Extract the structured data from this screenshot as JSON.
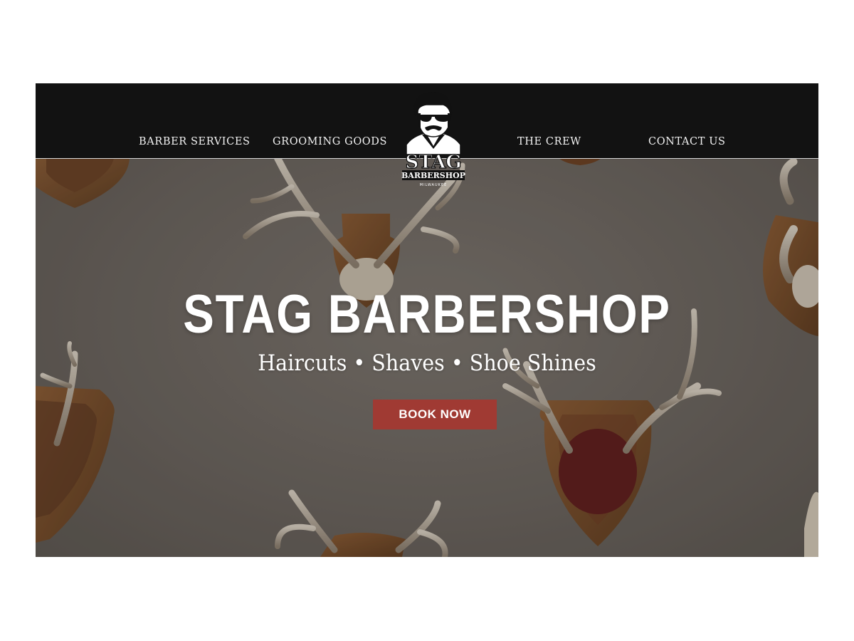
{
  "brand": {
    "logo_name": "STAG",
    "logo_sub": "BARBERSHOP",
    "logo_city": "MILWAUKEE",
    "logo_icon": "mustached-man-sunglasses-icon"
  },
  "nav": {
    "items": [
      {
        "label": "BARBER SERVICES"
      },
      {
        "label": "GROOMING GOODS"
      },
      {
        "label": "THE CREW"
      },
      {
        "label": "CONTACT US"
      }
    ]
  },
  "hero": {
    "title": "STAG BARBERSHOP",
    "subtitle": "Haircuts • Shaves • Shoe Shines",
    "cta_label": "BOOK NOW",
    "background": "mounted-antlers-on-wall"
  },
  "colors": {
    "header_bg": "#121212",
    "accent": "#a03a33",
    "text": "#ffffff",
    "page_bg": "#ffffff"
  }
}
